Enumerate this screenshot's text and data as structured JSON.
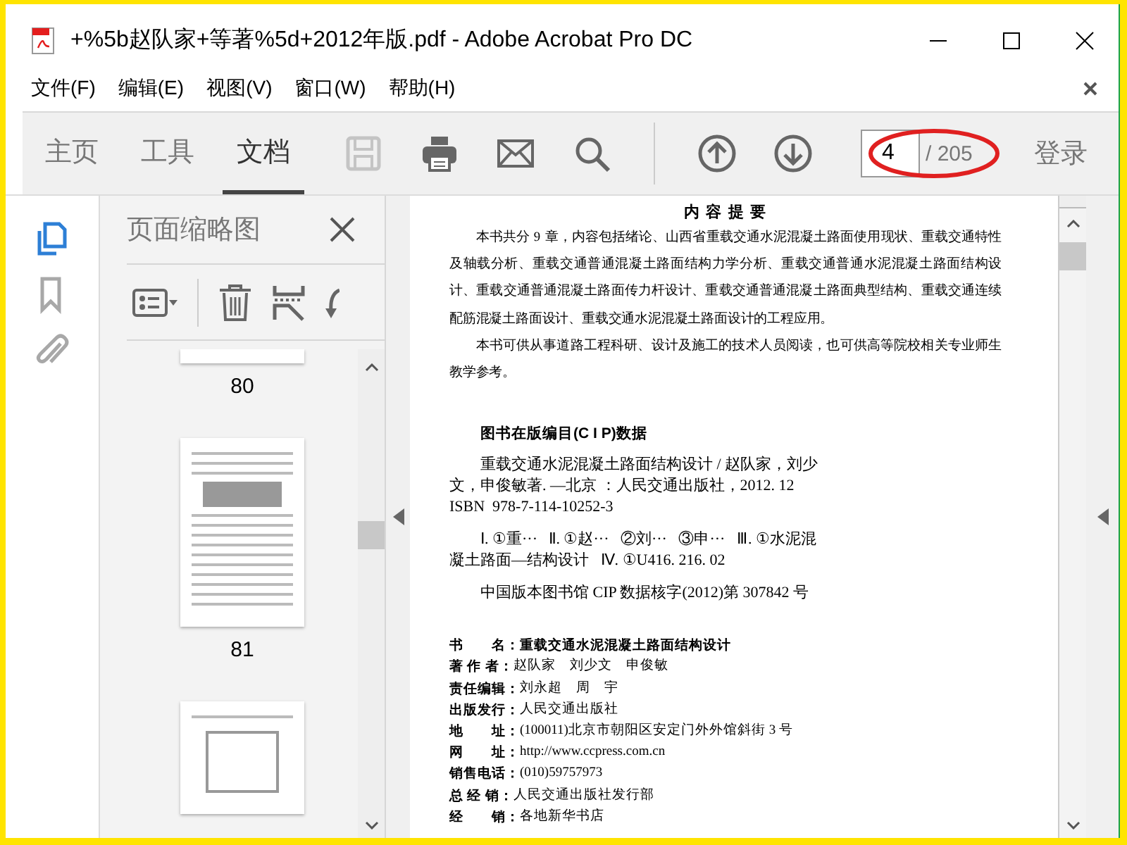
{
  "window": {
    "title": "+%5b赵队家+等著%5d+2012年版.pdf - Adobe Acrobat Pro DC"
  },
  "menu": [
    "文件(F)",
    "编辑(E)",
    "视图(V)",
    "窗口(W)",
    "帮助(H)"
  ],
  "toolbar": {
    "tabs": [
      {
        "label": "主页",
        "selected": false
      },
      {
        "label": "工具",
        "selected": false
      },
      {
        "label": "文档",
        "selected": true
      }
    ],
    "tools": [
      {
        "kind": "save",
        "disabled": true
      },
      {
        "kind": "print",
        "disabled": false
      },
      {
        "kind": "mail",
        "disabled": false
      },
      {
        "kind": "search",
        "disabled": false
      },
      {
        "kind": "prev",
        "disabled": false
      },
      {
        "kind": "next",
        "disabled": false
      }
    ],
    "page_number": "4",
    "page_total": "/ 205",
    "sign_in": "登录"
  },
  "rail": [
    {
      "kind": "pages",
      "selected": true
    },
    {
      "kind": "bookmark",
      "selected": false
    },
    {
      "kind": "attachment",
      "selected": false
    }
  ],
  "panel": {
    "title": "页面缩略图",
    "thumbnails": [
      {
        "label": "80"
      },
      {
        "label": "81"
      }
    ]
  },
  "document": {
    "heading": "内 容 提 要",
    "paragraphs": [
      "本书共分 9 章，内容包括绪论、山西省重载交通水泥混凝土路面使用现状、重载交通特性及轴载分析、重载交通普通混凝土路面结构力学分析、重载交通普通水泥混凝土路面结构设计、重载交通普通混凝土路面传力杆设计、重载交通普通混凝土路面典型结构、重载交通连续配筋混凝土路面设计、重载交通水泥混凝土路面设计的工程应用。",
      "本书可供从事道路工程科研、设计及施工的技术人员阅读，也可供高等院校相关专业师生教学参考。"
    ],
    "cip_heading": "图书在版编目(C I P)数据",
    "cip_blocks": [
      [
        "重载交通水泥混凝土路面结构设计 / 赵队家，刘少",
        "文，申俊敏著. —北京 ：人民交通出版社，2012. 12",
        "ISBN  978-7-114-10252-3"
      ],
      [
        "Ⅰ. ①重···   Ⅱ. ①赵···   ②刘···   ③申···   Ⅲ. ①水泥混",
        "凝土路面—结构设计   Ⅳ. ①U416. 216. 02"
      ],
      [
        "中国版本图书馆 CIP 数据核字(2012)第 307842 号"
      ]
    ],
    "info": [
      {
        "label": "书　　名：",
        "value": "重载交通水泥混凝土路面结构设计",
        "bold": true
      },
      {
        "label": "著 作 者：",
        "value": "赵队家　刘少文　申俊敏",
        "bold": false
      },
      {
        "label": "责任编辑：",
        "value": "刘永超　周　宇",
        "bold": false
      },
      {
        "label": "出版发行：",
        "value": "人民交通出版社",
        "bold": false
      },
      {
        "label": "地　　址：",
        "value": "(100011)北京市朝阳区安定门外外馆斜街 3 号",
        "bold": false
      },
      {
        "label": "网　　址：",
        "value": "http://www.ccpress.com.cn",
        "bold": false
      },
      {
        "label": "销售电话：",
        "value": "(010)59757973",
        "bold": false
      },
      {
        "label": "总 经 销：",
        "value": "人民交通出版社发行部",
        "bold": false
      },
      {
        "label": "经　　销：",
        "value": "各地新华书店",
        "bold": false
      }
    ]
  }
}
